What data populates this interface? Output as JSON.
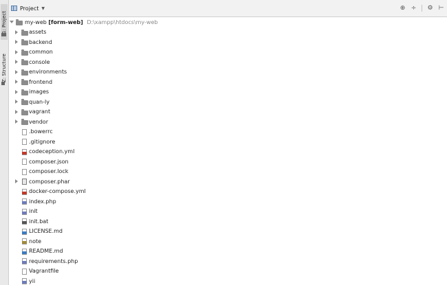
{
  "side_tabs": [
    {
      "label": "1: Project",
      "active": true
    },
    {
      "label": "Z: Structure",
      "active": false
    }
  ],
  "header": {
    "title": "Project",
    "tools": [
      "target-icon",
      "collapse-icon",
      "gear-icon",
      "hide-icon"
    ]
  },
  "tree": {
    "root": {
      "name": "my-web",
      "module": "[form-web]",
      "path": "D:\\xampp\\htdocs\\my-web"
    },
    "items": [
      {
        "name": "assets",
        "kind": "folder",
        "icon": "folder-icon"
      },
      {
        "name": "backend",
        "kind": "folder",
        "icon": "folder-icon"
      },
      {
        "name": "common",
        "kind": "folder",
        "icon": "folder-icon"
      },
      {
        "name": "console",
        "kind": "folder",
        "icon": "folder-icon"
      },
      {
        "name": "environments",
        "kind": "folder",
        "icon": "folder-icon"
      },
      {
        "name": "frontend",
        "kind": "folder",
        "icon": "folder-icon"
      },
      {
        "name": "images",
        "kind": "folder",
        "icon": "folder-icon"
      },
      {
        "name": "quan-ly",
        "kind": "folder",
        "icon": "folder-icon"
      },
      {
        "name": "vagrant",
        "kind": "folder",
        "icon": "folder-icon"
      },
      {
        "name": "vendor",
        "kind": "folder",
        "icon": "folder-icon"
      },
      {
        "name": ".bowerrc",
        "kind": "file",
        "icon": "file-icon",
        "tag": "none"
      },
      {
        "name": ".gitignore",
        "kind": "file",
        "icon": "file-icon",
        "tag": "none"
      },
      {
        "name": "codeception.yml",
        "kind": "file",
        "icon": "yml-file-icon",
        "tag": "yml"
      },
      {
        "name": "composer.json",
        "kind": "file",
        "icon": "json-file-icon",
        "tag": "none"
      },
      {
        "name": "composer.lock",
        "kind": "file",
        "icon": "file-icon",
        "tag": "none"
      },
      {
        "name": "composer.phar",
        "kind": "archive",
        "icon": "archive-icon",
        "tag": "none"
      },
      {
        "name": "docker-compose.yml",
        "kind": "file",
        "icon": "yml-file-icon",
        "tag": "yml"
      },
      {
        "name": "index.php",
        "kind": "file",
        "icon": "php-file-icon",
        "tag": "php"
      },
      {
        "name": "init",
        "kind": "file",
        "icon": "php-file-icon",
        "tag": "php"
      },
      {
        "name": "init.bat",
        "kind": "file",
        "icon": "bat-file-icon",
        "tag": "bat"
      },
      {
        "name": "LICENSE.md",
        "kind": "file",
        "icon": "md-file-icon",
        "tag": "md"
      },
      {
        "name": "note",
        "kind": "file",
        "icon": "text-file-icon",
        "tag": "txt"
      },
      {
        "name": "README.md",
        "kind": "file",
        "icon": "md-file-icon",
        "tag": "md"
      },
      {
        "name": "requirements.php",
        "kind": "file",
        "icon": "php-file-icon",
        "tag": "php"
      },
      {
        "name": "Vagrantfile",
        "kind": "file",
        "icon": "file-icon",
        "tag": "none"
      },
      {
        "name": "yii",
        "kind": "file",
        "icon": "php-file-icon",
        "tag": "php"
      }
    ]
  }
}
